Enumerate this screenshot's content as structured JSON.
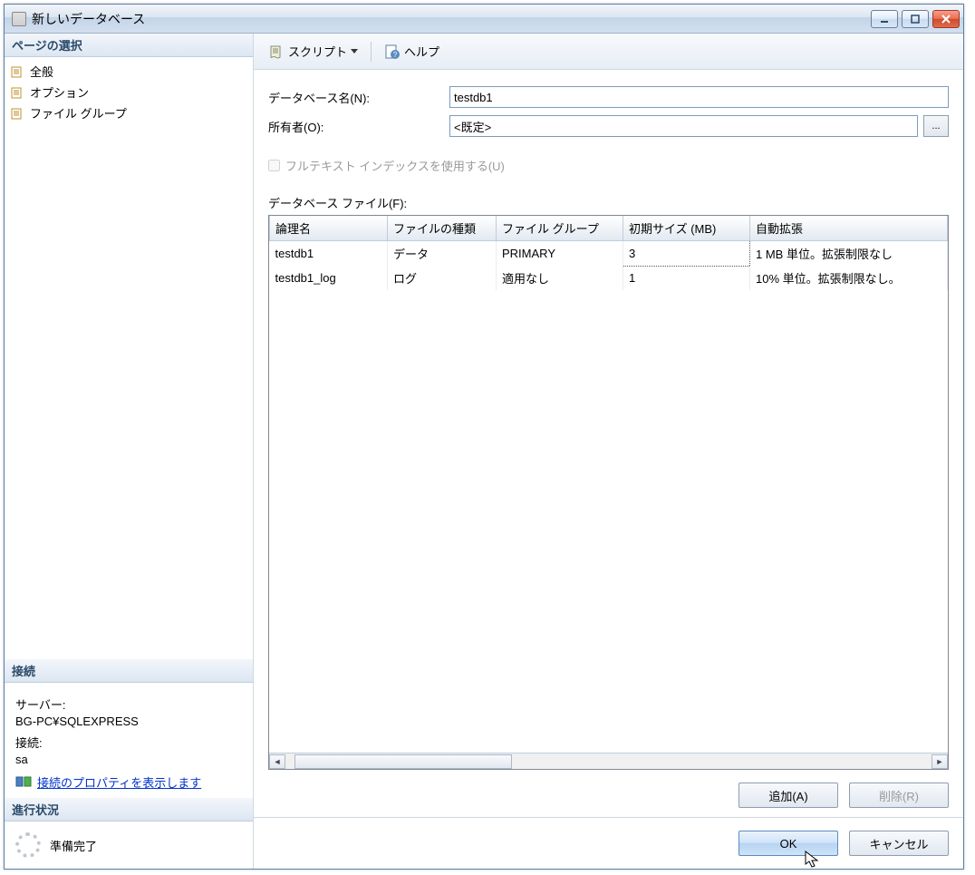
{
  "window": {
    "title": "新しいデータベース"
  },
  "sidebar": {
    "pages_header": "ページの選択",
    "items": [
      {
        "label": "全般"
      },
      {
        "label": "オプション"
      },
      {
        "label": "ファイル グループ"
      }
    ],
    "connection": {
      "header": "接続",
      "server_label": "サーバー:",
      "server_value": "BG-PC¥SQLEXPRESS",
      "conn_label": "接続:",
      "conn_value": "sa",
      "link": "接続のプロパティを表示します"
    },
    "progress": {
      "header": "進行状況",
      "status": "準備完了"
    }
  },
  "toolbar": {
    "script": "スクリプト",
    "help": "ヘルプ"
  },
  "form": {
    "dbname_label": "データベース名(N):",
    "dbname_value": "testdb1",
    "owner_label": "所有者(O):",
    "owner_value": "<既定>",
    "browse": "...",
    "fulltext_label": "フルテキスト インデックスを使用する(U)",
    "files_label": "データベース ファイル(F):"
  },
  "table": {
    "headers": [
      "論理名",
      "ファイルの種類",
      "ファイル グループ",
      "初期サイズ (MB)",
      "自動拡張"
    ],
    "rows": [
      {
        "c0": "testdb1",
        "c1": "データ",
        "c2": "PRIMARY",
        "c3": "3",
        "c4": "1 MB 単位。拡張制限なし"
      },
      {
        "c0": "testdb1_log",
        "c1": "ログ",
        "c2": "適用なし",
        "c3": "1",
        "c4": "10% 単位。拡張制限なし。"
      }
    ]
  },
  "buttons": {
    "add": "追加(A)",
    "remove": "削除(R)",
    "ok": "OK",
    "cancel": "キャンセル"
  }
}
